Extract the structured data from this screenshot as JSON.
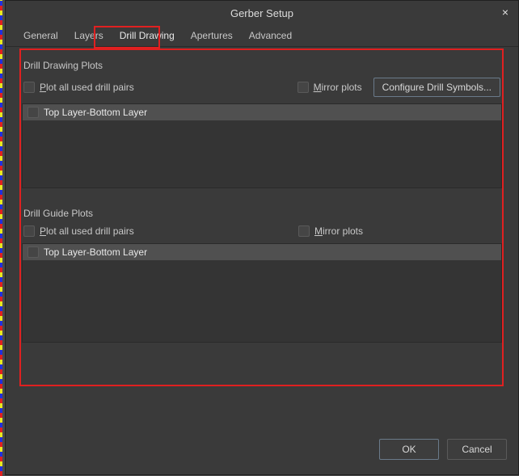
{
  "dialog": {
    "title": "Gerber Setup",
    "close_icon": "×"
  },
  "tabs": {
    "items": [
      {
        "label": "General"
      },
      {
        "label": "Layers"
      },
      {
        "label": "Drill Drawing"
      },
      {
        "label": "Apertures"
      },
      {
        "label": "Advanced"
      }
    ],
    "active_index": 2
  },
  "drill_drawing": {
    "section_label": "Drill Drawing Plots",
    "plot_all_prefix": "P",
    "plot_all_rest": "lot all used drill pairs",
    "mirror_prefix": "M",
    "mirror_rest": "irror plots",
    "configure_btn": "Configure Drill Symbols...",
    "list_item": "Top Layer-Bottom Layer"
  },
  "drill_guide": {
    "section_label": "Drill Guide Plots",
    "plot_all_prefix": "P",
    "plot_all_rest": "lot all used drill pairs",
    "mirror_prefix": "M",
    "mirror_rest": "irror plots",
    "list_item": "Top Layer-Bottom Layer"
  },
  "footer": {
    "ok": "OK",
    "cancel": "Cancel"
  }
}
